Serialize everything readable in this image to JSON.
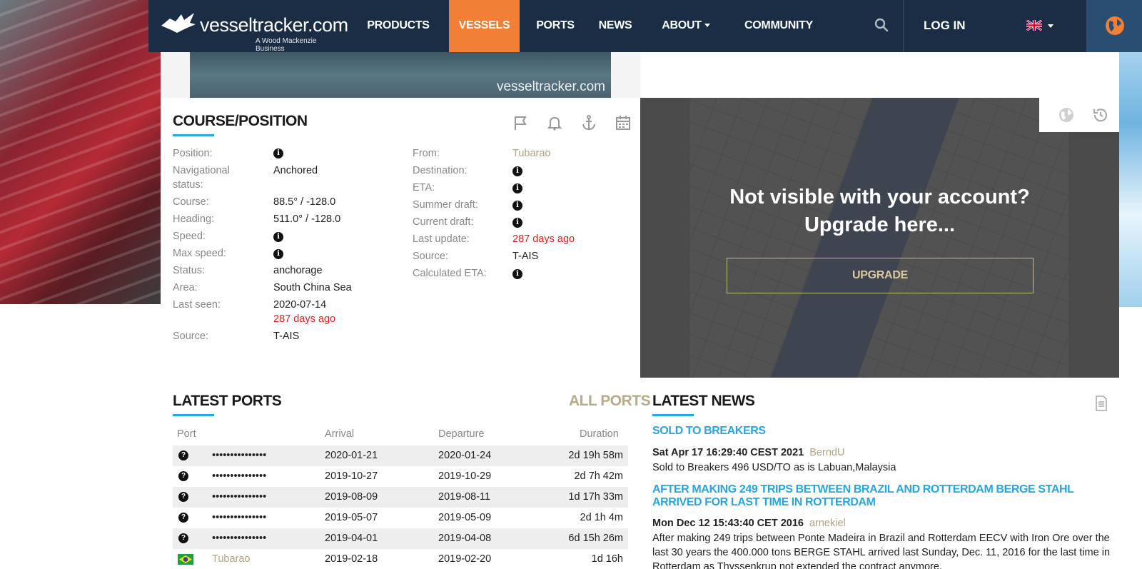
{
  "header": {
    "logo_text": "vesseltracker.com",
    "logo_sub": "A Wood Mackenzie Business",
    "nav": [
      {
        "label": "PRODUCTS"
      },
      {
        "label": "VESSELS"
      },
      {
        "label": "PORTS"
      },
      {
        "label": "NEWS"
      },
      {
        "label": "ABOUT"
      },
      {
        "label": "COMMUNITY"
      }
    ],
    "login": "LOG IN",
    "active_color": "#f27f36",
    "bg_color": "#1a2d44"
  },
  "photo": {
    "watermark": "vesseltracker.com"
  },
  "course": {
    "title": "COURSE/POSITION",
    "left": [
      {
        "label": "Position:",
        "value": ""
      },
      {
        "label": "Navigational status:",
        "value": "Anchored"
      },
      {
        "label": "Course:",
        "value": "88.5° / -128.0"
      },
      {
        "label": "Heading:",
        "value": "511.0° / -128.0"
      },
      {
        "label": "Speed:",
        "value": ""
      },
      {
        "label": "Max speed:",
        "value": ""
      },
      {
        "label": "Status:",
        "value": "anchorage"
      },
      {
        "label": "Area:",
        "value": "South China Sea"
      },
      {
        "label": "Last seen:",
        "value": "2020-07-14",
        "value2": "287 days ago"
      },
      {
        "label": "Source:",
        "value": "T-AIS"
      }
    ],
    "right": [
      {
        "label": "From:",
        "value": "Tubarao"
      },
      {
        "label": "Destination:",
        "value": ""
      },
      {
        "label": "ETA:",
        "value": ""
      },
      {
        "label": "Summer draft:",
        "value": ""
      },
      {
        "label": "Current draft:",
        "value": ""
      },
      {
        "label": "Last update:",
        "value": "287 days ago"
      },
      {
        "label": "Source:",
        "value": "T-AIS"
      },
      {
        "label": "Calculated ETA:",
        "value": ""
      }
    ]
  },
  "map": {
    "message_line1": "Not visible with your account?",
    "message_line2": "Upgrade here...",
    "button": "UPGRADE"
  },
  "ports": {
    "title": "LATEST PORTS",
    "all_link": "ALL PORTS",
    "columns": [
      "Port",
      "Arrival",
      "Departure",
      "Duration"
    ],
    "rows": [
      {
        "port": "•••••••••••••••",
        "arrival": "2020-01-21",
        "departure": "2020-01-24",
        "duration": "2d 19h 58m"
      },
      {
        "port": "•••••••••••••••",
        "arrival": "2019-10-27",
        "departure": "2019-10-29",
        "duration": "2d 7h 42m"
      },
      {
        "port": "•••••••••••••••",
        "arrival": "2019-08-09",
        "departure": "2019-08-11",
        "duration": "1d 17h 33m"
      },
      {
        "port": "•••••••••••••••",
        "arrival": "2019-05-07",
        "departure": "2019-05-09",
        "duration": "2d 1h 4m"
      },
      {
        "port": "•••••••••••••••",
        "arrival": "2019-04-01",
        "departure": "2019-04-08",
        "duration": "6d 15h 26m"
      },
      {
        "port": "Tubarao",
        "arrival": "2019-02-18",
        "departure": "2019-02-20",
        "duration": "1d 16h"
      }
    ]
  },
  "news": {
    "title": "LATEST NEWS",
    "items": [
      {
        "headline": "SOLD TO BREAKERS",
        "date": "Sat Apr 17 16:29:40 CEST 2021",
        "author": "BerndU",
        "body": "Sold to Breakers 496 USD/TO as is Labuan,Malaysia"
      },
      {
        "headline": "AFTER MAKING 249 TRIPS BETWEEN BRAZIL AND ROTTERDAM BERGE STAHL ARRIVED FOR LAST TIME IN ROTTERDAM",
        "date": "Mon Dec 12 15:43:40 CET 2016",
        "author": "arnekiel",
        "body": "After making 249 trips between Ponte Madeira in Brazil and Rotterdam EECV with Iron Ore over the last 30 years the 400.000 tons BERGE STAHL arrived last Sunday, Dec. 11, 2016 for the last time in Rotterdam as Thyssenkrup not extended the contract anymore."
      }
    ]
  }
}
